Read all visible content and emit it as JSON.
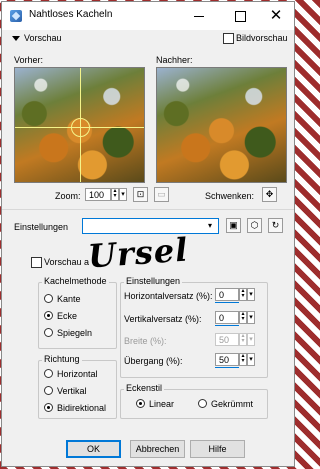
{
  "window": {
    "title": "Nahtloses Kacheln"
  },
  "preview": {
    "toggle_label": "Vorschau",
    "checkbox_label": "Bildvorschau",
    "before_label": "Vorher:",
    "after_label": "Nachher:",
    "zoom_label": "Zoom:",
    "zoom_value": "100",
    "pan_label": "Schwenken:"
  },
  "settings": {
    "label": "Einstellungen",
    "preset_value": ""
  },
  "options": {
    "preview_on_image_label": "Vorschau a"
  },
  "tile_method": {
    "title": "Kachelmethode",
    "items": [
      {
        "label": "Kante",
        "selected": false
      },
      {
        "label": "Ecke",
        "selected": true
      },
      {
        "label": "Spiegeln",
        "selected": false
      }
    ]
  },
  "direction": {
    "title": "Richtung",
    "items": [
      {
        "label": "Horizontal",
        "selected": false
      },
      {
        "label": "Vertikal",
        "selected": false
      },
      {
        "label": "Bidirektional",
        "selected": true
      }
    ]
  },
  "params": {
    "title": "Einstellungen",
    "horizontal_offset_label": "Horizontalversatz (%):",
    "horizontal_offset_value": "0",
    "vertical_offset_label": "Vertikalversatz (%):",
    "vertical_offset_value": "0",
    "width_label": "Breite (%):",
    "width_value": "50",
    "transition_label": "Übergang (%):",
    "transition_value": "50"
  },
  "corner_style": {
    "title": "Eckenstil",
    "items": [
      {
        "label": "Linear",
        "selected": true
      },
      {
        "label": "Gekrümmt",
        "selected": false
      }
    ]
  },
  "watermark": {
    "text": "Ursel"
  },
  "buttons": {
    "ok": "OK",
    "cancel": "Abbrechen",
    "help": "Hilfe"
  },
  "colors": {
    "accent": "#0078d7",
    "window_bg": "#f0f0f0"
  }
}
